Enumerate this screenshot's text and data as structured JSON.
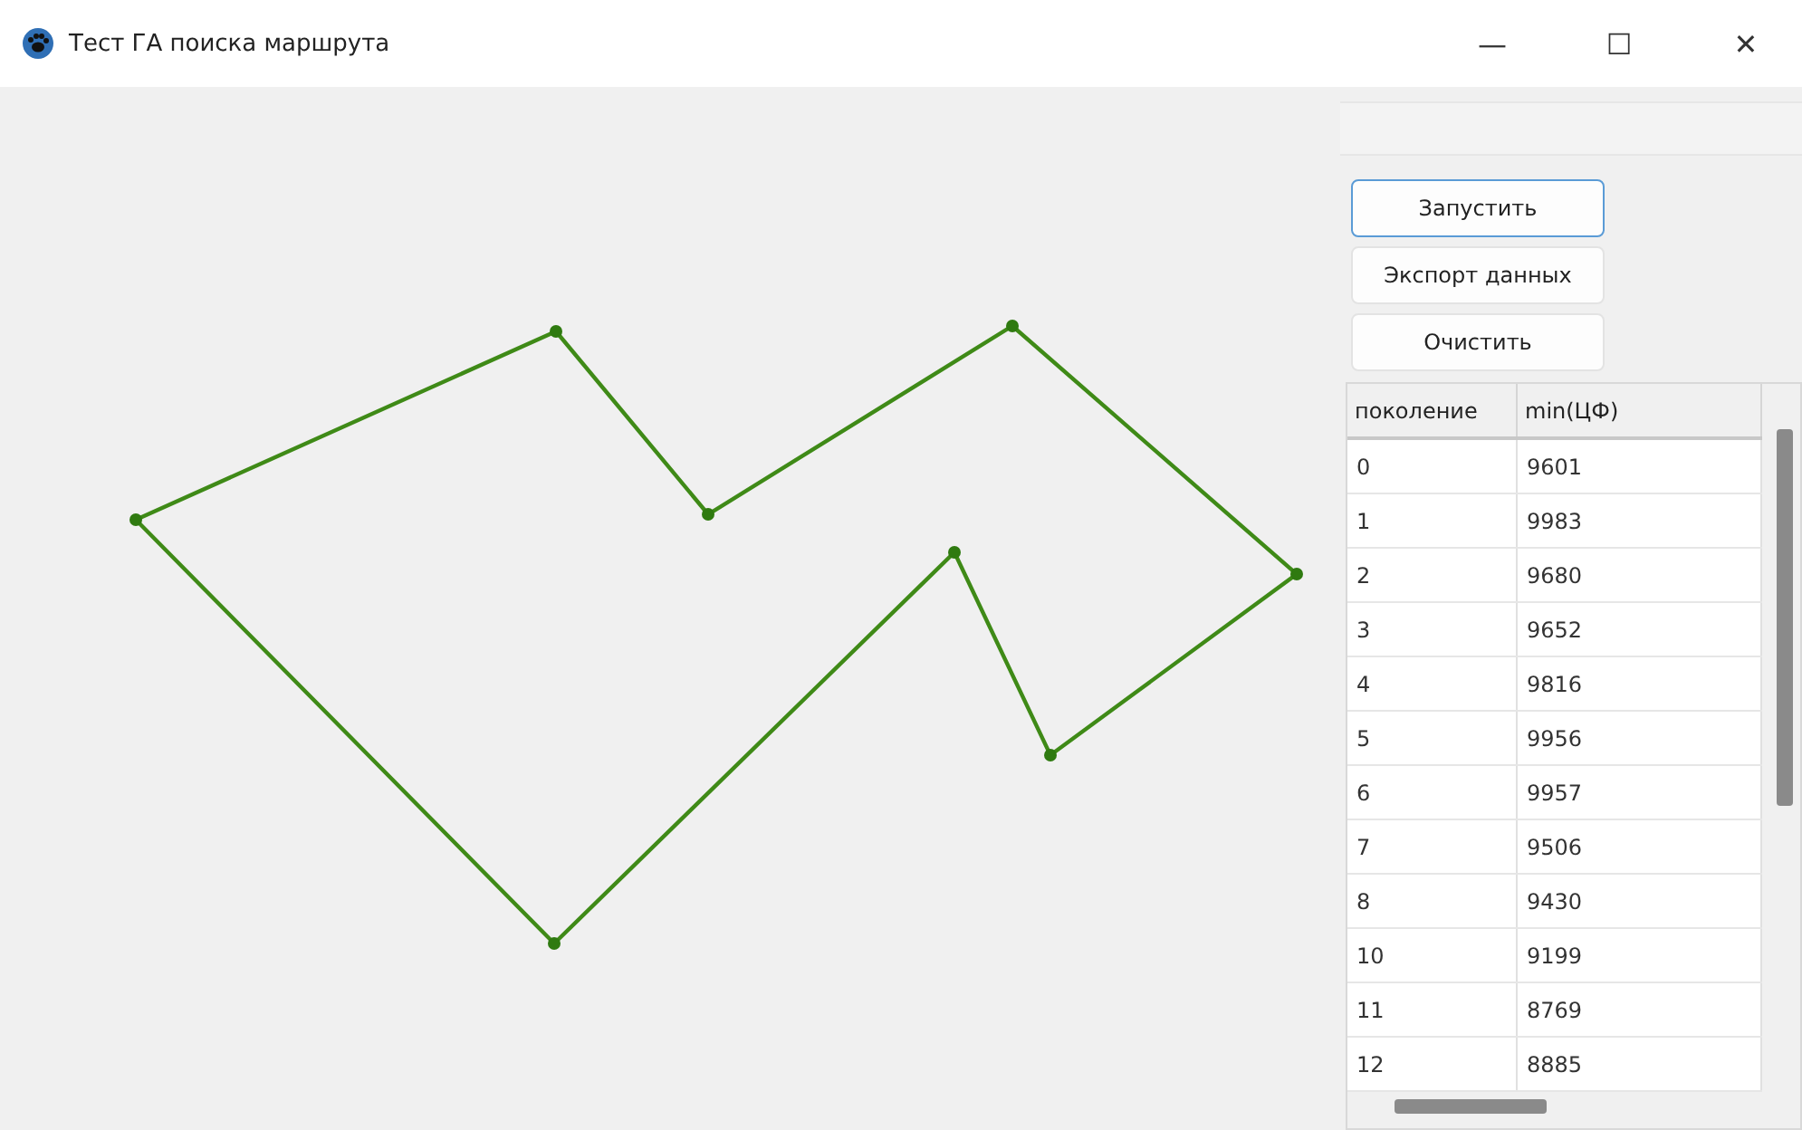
{
  "window": {
    "title": "Тест ГА поиска маршрута",
    "controls": [
      "—",
      "☐",
      "✕"
    ]
  },
  "buttons": [
    {
      "label": "Запустить",
      "selected": true
    },
    {
      "label": "Экспорт данных",
      "selected": false
    },
    {
      "label": "Очистить",
      "selected": false
    }
  ],
  "table": {
    "columns": [
      "поколение",
      "min(ЦФ)"
    ],
    "rows": [
      [
        "0",
        "9601"
      ],
      [
        "1",
        "9983"
      ],
      [
        "2",
        "9680"
      ],
      [
        "3",
        "9652"
      ],
      [
        "4",
        "9816"
      ],
      [
        "5",
        "9956"
      ],
      [
        "6",
        "9957"
      ],
      [
        "7",
        "9506"
      ],
      [
        "8",
        "9430"
      ],
      [
        "10",
        "9199"
      ],
      [
        "11",
        "8769"
      ],
      [
        "12",
        "8885"
      ]
    ]
  }
}
